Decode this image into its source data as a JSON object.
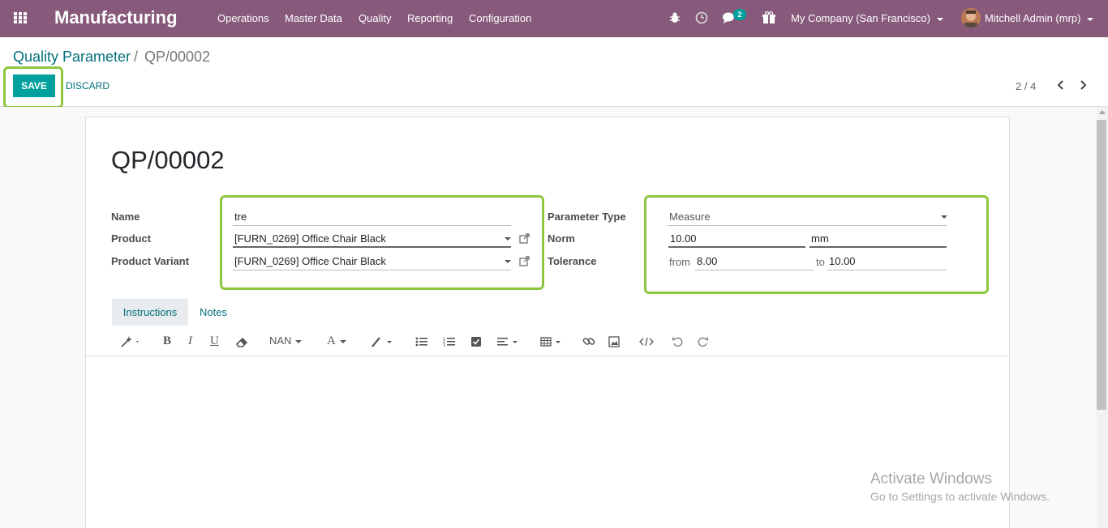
{
  "navbar": {
    "brand": "Manufacturing",
    "menu": [
      "Operations",
      "Master Data",
      "Quality",
      "Reporting",
      "Configuration"
    ],
    "messages_badge": "2",
    "company": "My Company (San Francisco)",
    "user": "Mitchell Admin (mrp)"
  },
  "breadcrumb": {
    "parent": "Quality Parameter",
    "separator": "/",
    "current": "QP/00002"
  },
  "actions": {
    "save_label": "SAVE",
    "discard_label": "DISCARD"
  },
  "pager": {
    "text": "2 / 4"
  },
  "record": {
    "title": "QP/00002",
    "labels": {
      "name": "Name",
      "product": "Product",
      "product_variant": "Product Variant",
      "parameter_type": "Parameter Type",
      "norm": "Norm",
      "tolerance": "Tolerance",
      "from": "from",
      "to": "to"
    },
    "values": {
      "name": "tre",
      "product": "[FURN_0269] Office Chair Black",
      "product_variant": "[FURN_0269] Office Chair Black",
      "parameter_type": "Measure",
      "norm": "10.00",
      "norm_unit": "mm",
      "tolerance_from": "8.00",
      "tolerance_to": "10.00"
    }
  },
  "tabs": [
    "Instructions",
    "Notes"
  ],
  "editor_toolbar": {
    "font_size": "NAN"
  },
  "watermark": {
    "line1": "Activate Windows",
    "line2": "Go to Settings to activate Windows."
  },
  "colors": {
    "navbar": "#875a7b",
    "primary": "#00a09d",
    "link": "#00707a",
    "highlight": "#8dc63f"
  }
}
